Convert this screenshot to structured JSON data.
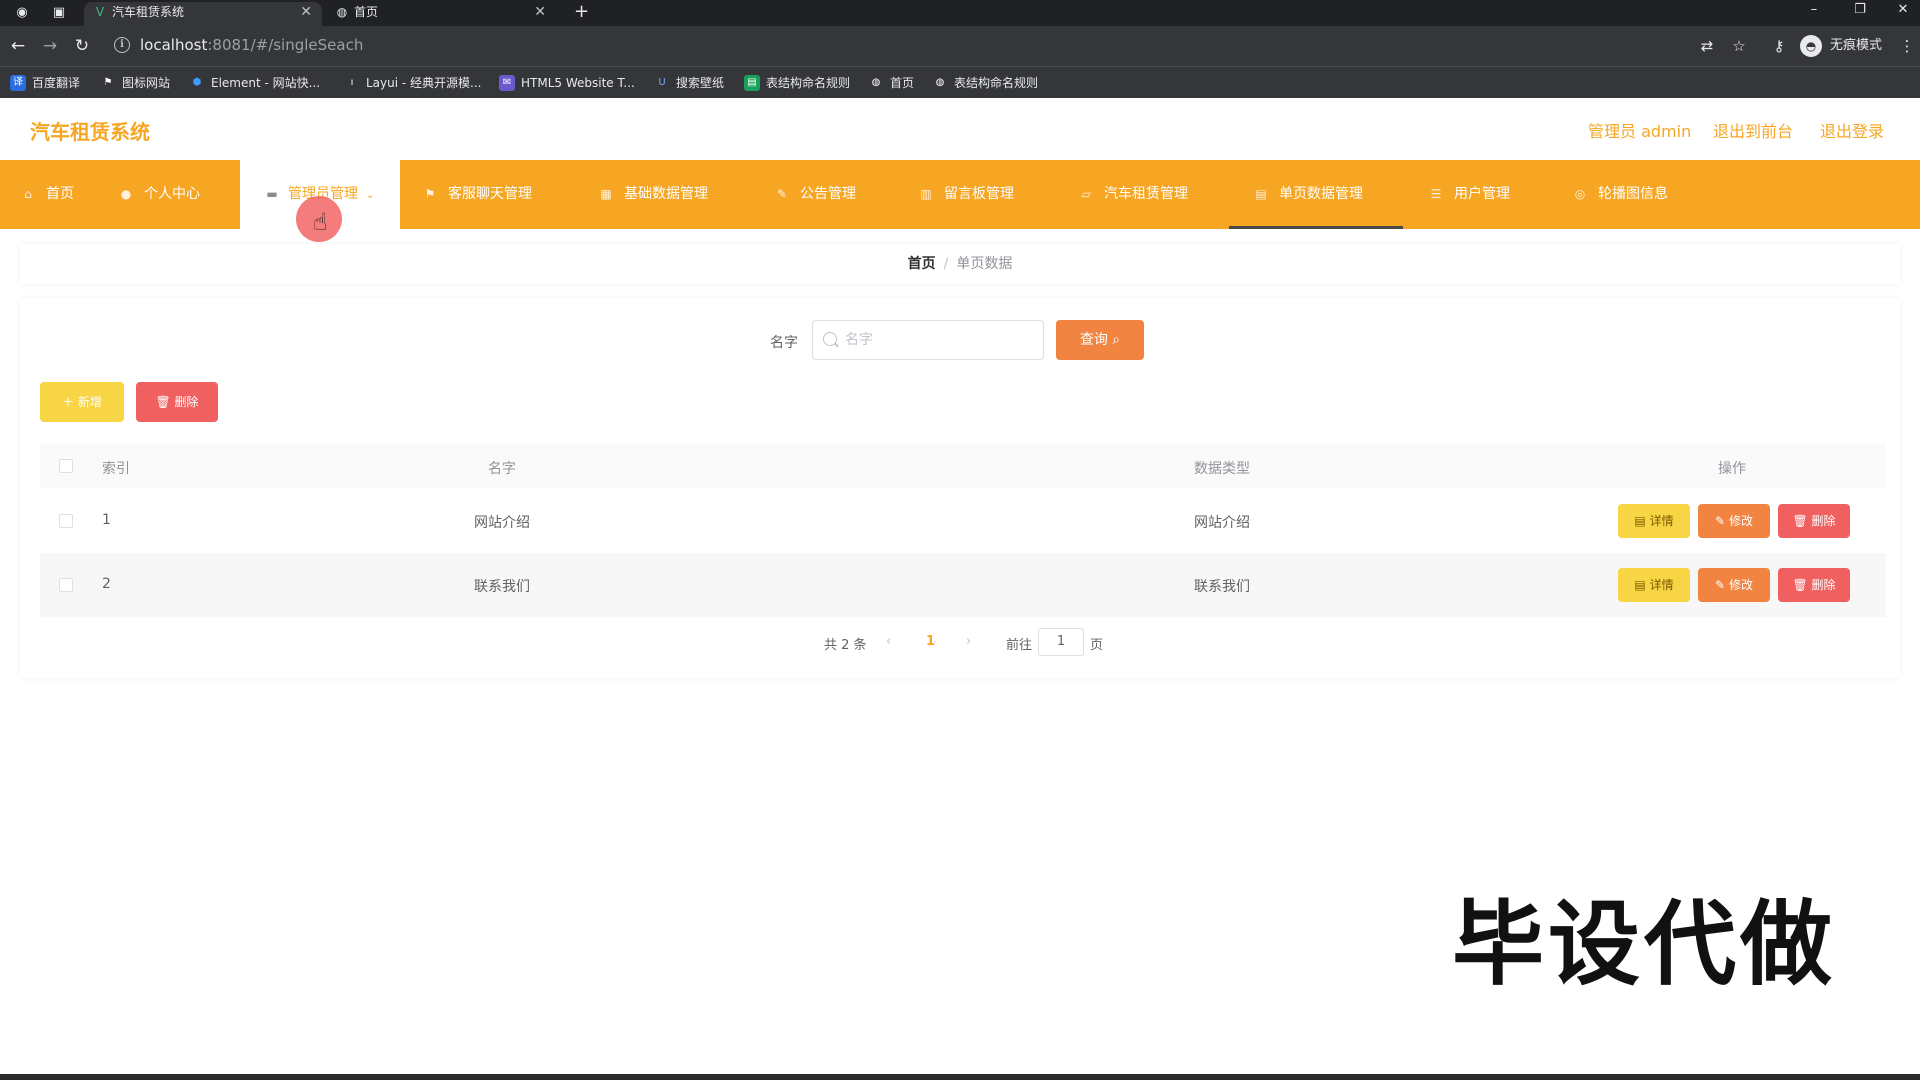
{
  "browser": {
    "tabs": [
      {
        "title": "汽车租赁系统",
        "favicon": "vue-logo-icon",
        "close": "✕"
      },
      {
        "title": "首页",
        "favicon": "globe-icon",
        "close": "✕"
      }
    ],
    "new_tab": "+",
    "url_host": "localhost",
    "url_path": ":8081/#/singleSeach",
    "incognito_label": "无痕模式",
    "bookmarks": [
      {
        "label": "百度翻译",
        "icon": "baidu-translate-icon",
        "color": "#2b6de0"
      },
      {
        "label": "图标网站",
        "icon": "flag-icon",
        "color": "#555555"
      },
      {
        "label": "Element - 网站快...",
        "icon": "element-icon",
        "color": "#409eff"
      },
      {
        "label": "Layui - 经典开源模...",
        "icon": "layui-icon",
        "color": "#666666"
      },
      {
        "label": "HTML5 Website T...",
        "icon": "html5-icon",
        "color": "#6a5acd"
      },
      {
        "label": "搜索壁纸",
        "icon": "wallpaper-icon",
        "color": "#4a6fd8"
      },
      {
        "label": "表结构命名规则",
        "icon": "sheet-icon",
        "color": "#18a058"
      },
      {
        "label": "首页",
        "icon": "globe-icon",
        "color": "#777777"
      },
      {
        "label": "表结构命名规则",
        "icon": "globe-icon",
        "color": "#777777"
      }
    ]
  },
  "header": {
    "app_title": "汽车租赁系统",
    "admin_label": "管理员 admin",
    "exit_front": "退出到前台",
    "logout": "退出登录"
  },
  "menu": [
    {
      "label": "首页",
      "icon": "home-icon"
    },
    {
      "label": "个人中心",
      "icon": "user-icon"
    },
    {
      "label": "管理员管理",
      "icon": "monitor-icon",
      "caret": "⌄"
    },
    {
      "label": "客服聊天管理",
      "icon": "flag-icon"
    },
    {
      "label": "基础数据管理",
      "icon": "grid-icon"
    },
    {
      "label": "公告管理",
      "icon": "notice-icon"
    },
    {
      "label": "留言板管理",
      "icon": "message-icon"
    },
    {
      "label": "汽车租赁管理",
      "icon": "car-icon"
    },
    {
      "label": "单页数据管理",
      "icon": "doc-icon"
    },
    {
      "label": "用户管理",
      "icon": "users-icon"
    },
    {
      "label": "轮播图信息",
      "icon": "image-icon"
    }
  ],
  "breadcrumb": {
    "home": "首页",
    "separator": "/",
    "current": "单页数据"
  },
  "search": {
    "label": "名字",
    "placeholder": "名字",
    "query_button": "查询"
  },
  "actions": {
    "add": "新增",
    "delete": "删除"
  },
  "table": {
    "headers": {
      "index": "索引",
      "name": "名字",
      "type": "数据类型",
      "ops": "操作"
    },
    "rows": [
      {
        "index": "1",
        "name": "网站介绍",
        "type": "网站介绍"
      },
      {
        "index": "2",
        "name": "联系我们",
        "type": "联系我们"
      }
    ],
    "row_buttons": {
      "detail": "详情",
      "edit": "修改",
      "delete": "删除"
    }
  },
  "pagination": {
    "total": "共 2 条",
    "current_page": "1",
    "goto_label": "前往",
    "goto_value": "1",
    "page_suffix": "页"
  },
  "watermark": "毕设代做",
  "colors": {
    "primary": "#f6a623",
    "query": "#f08440",
    "add": "#f7d545",
    "danger": "#f06060"
  }
}
